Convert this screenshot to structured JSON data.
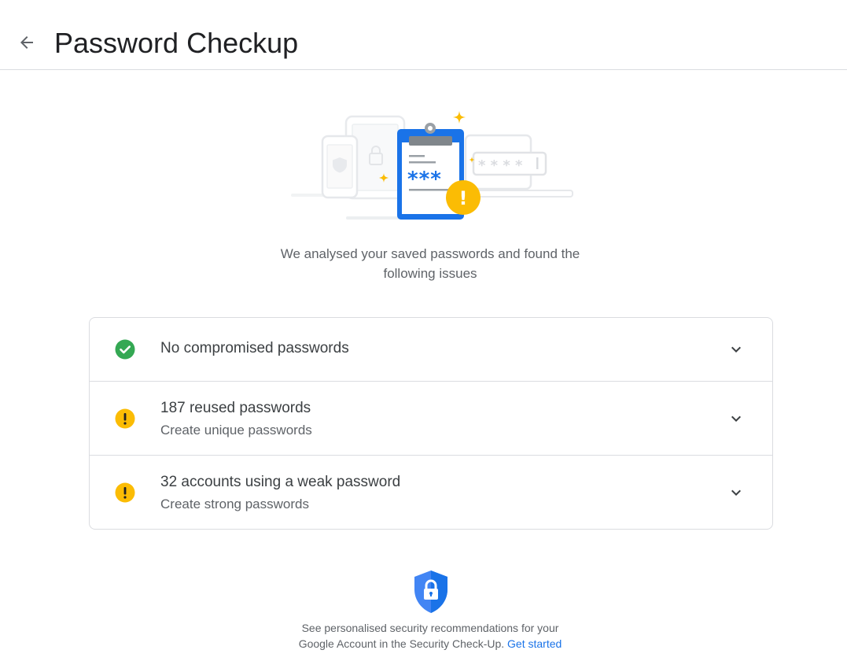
{
  "header": {
    "title": "Password Checkup",
    "back_icon": "arrow-back-icon"
  },
  "hero": {
    "illustration": "password-checkup-illustration",
    "mask_text": "* * * *",
    "clipboard_text": "***",
    "alert_symbol": "!"
  },
  "intro": {
    "line1": "We analysed your saved passwords and found the",
    "line2": "following issues"
  },
  "issues": [
    {
      "title": "No compromised passwords",
      "subtitle": "",
      "status": "ok",
      "icon": "check-circle-icon",
      "color": "#34a853"
    },
    {
      "title": "187 reused passwords",
      "subtitle": "Create unique passwords",
      "status": "warning",
      "icon": "warning-circle-icon",
      "color": "#fbbc04"
    },
    {
      "title": "32 accounts using a weak password",
      "subtitle": "Create strong passwords",
      "status": "warning",
      "icon": "warning-circle-icon",
      "color": "#fbbc04"
    }
  ],
  "footer": {
    "icon": "security-shield-icon",
    "line1": "See personalised security recommendations for your",
    "line2": "Google Account in the Security Check-Up.",
    "link": "Get started"
  },
  "colors": {
    "accent": "#1a73e8",
    "ok": "#34a853",
    "warning": "#fbbc04",
    "divider": "#dadce0"
  }
}
